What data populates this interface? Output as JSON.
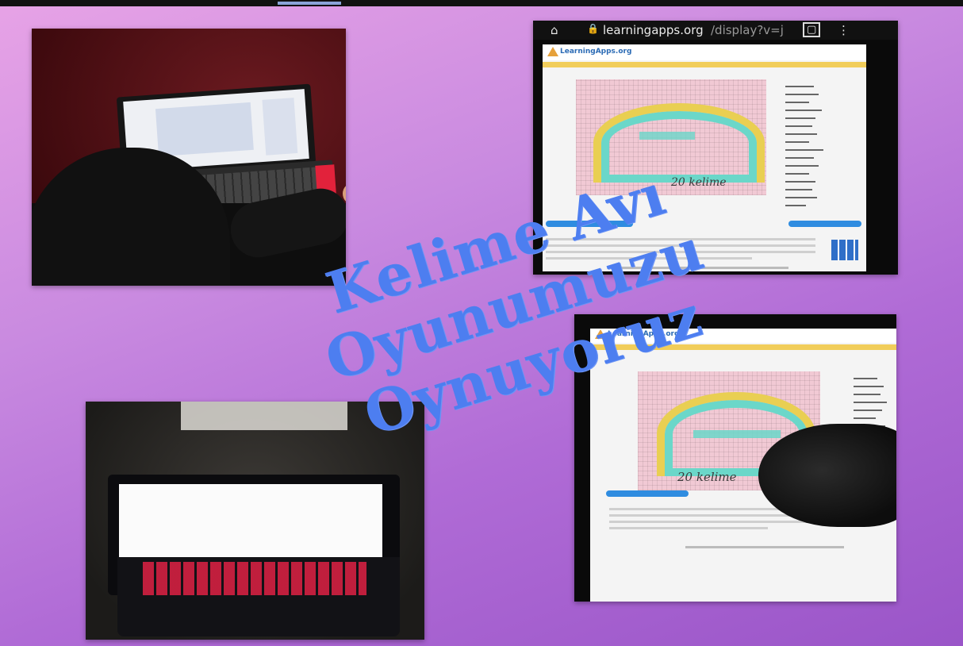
{
  "title": {
    "line1": "Kelime Avı",
    "line2": "Oyunumuzu",
    "line3": "Oynuyoruz"
  },
  "phone_top": {
    "url_domain": "learningapps.org",
    "url_path": "/display?v=j",
    "site_name": "LearningApps.org",
    "word_count_label": "20 kelime"
  },
  "phone_bottom": {
    "site_name": "LearningApps.org",
    "word_count_label": "20 kelime"
  },
  "colors": {
    "title_text": "#4d7ef0",
    "background_top": "#e7a3e6",
    "background_bottom": "#9a55c8"
  },
  "icons": {
    "home": "home-icon",
    "lock": "lock-icon",
    "tabs": "tabs-icon",
    "menu": "more-vert-icon"
  }
}
